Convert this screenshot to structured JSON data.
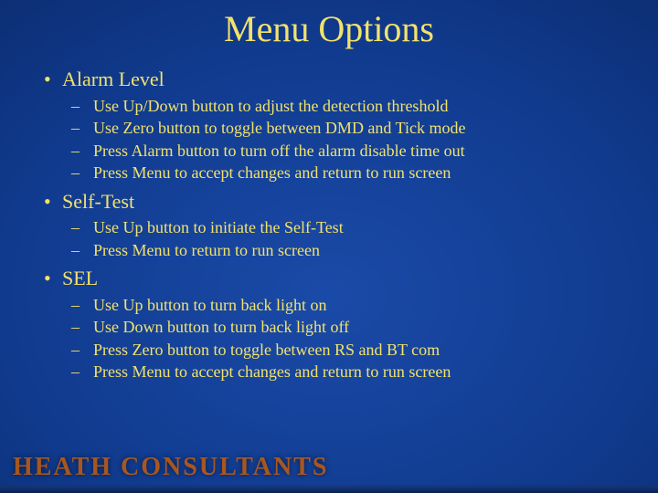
{
  "title": "Menu Options",
  "sections": [
    {
      "heading": "Alarm Level",
      "items": [
        "Use Up/Down button to adjust the detection threshold",
        "Use Zero button to toggle between DMD and Tick mode",
        "Press Alarm button to turn off the alarm disable time out",
        "Press Menu to accept changes and return to run screen"
      ]
    },
    {
      "heading": "Self-Test",
      "items": [
        "Use Up button to initiate the Self-Test",
        "Press Menu to return to run screen"
      ]
    },
    {
      "heading": "SEL",
      "items": [
        "Use Up button to turn back light on",
        "Use Down button to turn back light off",
        "Press Zero button to toggle between RS and BT com",
        "Press Menu to accept changes and return to run screen"
      ]
    }
  ],
  "footer_logo": "HEATH CONSULTANTS"
}
